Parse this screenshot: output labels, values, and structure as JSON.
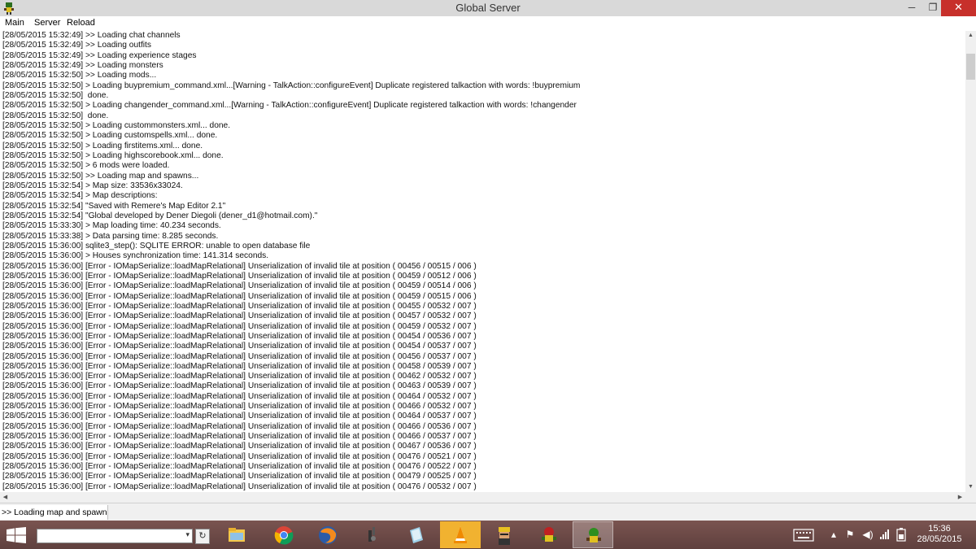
{
  "window": {
    "title": "Global Server",
    "minimize": "─",
    "maximize": "❐",
    "close": "✕"
  },
  "menu": [
    "Main",
    "Server",
    "Reload"
  ],
  "console_lines": [
    "[28/05/2015 15:32:49] >> Loading chat channels",
    "[28/05/2015 15:32:49] >> Loading outfits",
    "[28/05/2015 15:32:49] >> Loading experience stages",
    "[28/05/2015 15:32:49] >> Loading monsters",
    "[28/05/2015 15:32:50] >> Loading mods...",
    "[28/05/2015 15:32:50] > Loading buypremium_command.xml...[Warning - TalkAction::configureEvent] Duplicate registered talkaction with words: !buypremium",
    "[28/05/2015 15:32:50]  done.",
    "[28/05/2015 15:32:50] > Loading changender_command.xml...[Warning - TalkAction::configureEvent] Duplicate registered talkaction with words: !changender",
    "[28/05/2015 15:32:50]  done.",
    "[28/05/2015 15:32:50] > Loading custommonsters.xml... done.",
    "[28/05/2015 15:32:50] > Loading customspells.xml... done.",
    "[28/05/2015 15:32:50] > Loading firstitems.xml... done.",
    "[28/05/2015 15:32:50] > Loading highscorebook.xml... done.",
    "[28/05/2015 15:32:50] > 6 mods were loaded.",
    "[28/05/2015 15:32:50] >> Loading map and spawns...",
    "[28/05/2015 15:32:54] > Map size: 33536x33024.",
    "[28/05/2015 15:32:54] > Map descriptions:",
    "[28/05/2015 15:32:54] \"Saved with Remere's Map Editor 2.1\"",
    "[28/05/2015 15:32:54] \"Global developed by Dener Diegoli (dener_d1@hotmail.com).\"",
    "[28/05/2015 15:33:30] > Map loading time: 40.234 seconds.",
    "[28/05/2015 15:33:38] > Data parsing time: 8.285 seconds.",
    "[28/05/2015 15:36:00] sqlite3_step(): SQLITE ERROR: unable to open database file",
    "[28/05/2015 15:36:00] > Houses synchronization time: 141.314 seconds.",
    "[28/05/2015 15:36:00] [Error - IOMapSerialize::loadMapRelational] Unserialization of invalid tile at position ( 00456 / 00515 / 006 )",
    "[28/05/2015 15:36:00] [Error - IOMapSerialize::loadMapRelational] Unserialization of invalid tile at position ( 00459 / 00512 / 006 )",
    "[28/05/2015 15:36:00] [Error - IOMapSerialize::loadMapRelational] Unserialization of invalid tile at position ( 00459 / 00514 / 006 )",
    "[28/05/2015 15:36:00] [Error - IOMapSerialize::loadMapRelational] Unserialization of invalid tile at position ( 00459 / 00515 / 006 )",
    "[28/05/2015 15:36:00] [Error - IOMapSerialize::loadMapRelational] Unserialization of invalid tile at position ( 00455 / 00532 / 007 )",
    "[28/05/2015 15:36:00] [Error - IOMapSerialize::loadMapRelational] Unserialization of invalid tile at position ( 00457 / 00532 / 007 )",
    "[28/05/2015 15:36:00] [Error - IOMapSerialize::loadMapRelational] Unserialization of invalid tile at position ( 00459 / 00532 / 007 )",
    "[28/05/2015 15:36:00] [Error - IOMapSerialize::loadMapRelational] Unserialization of invalid tile at position ( 00454 / 00536 / 007 )",
    "[28/05/2015 15:36:00] [Error - IOMapSerialize::loadMapRelational] Unserialization of invalid tile at position ( 00454 / 00537 / 007 )",
    "[28/05/2015 15:36:00] [Error - IOMapSerialize::loadMapRelational] Unserialization of invalid tile at position ( 00456 / 00537 / 007 )",
    "[28/05/2015 15:36:00] [Error - IOMapSerialize::loadMapRelational] Unserialization of invalid tile at position ( 00458 / 00539 / 007 )",
    "[28/05/2015 15:36:00] [Error - IOMapSerialize::loadMapRelational] Unserialization of invalid tile at position ( 00462 / 00532 / 007 )",
    "[28/05/2015 15:36:00] [Error - IOMapSerialize::loadMapRelational] Unserialization of invalid tile at position ( 00463 / 00539 / 007 )",
    "[28/05/2015 15:36:00] [Error - IOMapSerialize::loadMapRelational] Unserialization of invalid tile at position ( 00464 / 00532 / 007 )",
    "[28/05/2015 15:36:00] [Error - IOMapSerialize::loadMapRelational] Unserialization of invalid tile at position ( 00466 / 00532 / 007 )",
    "[28/05/2015 15:36:00] [Error - IOMapSerialize::loadMapRelational] Unserialization of invalid tile at position ( 00464 / 00537 / 007 )",
    "[28/05/2015 15:36:00] [Error - IOMapSerialize::loadMapRelational] Unserialization of invalid tile at position ( 00466 / 00536 / 007 )",
    "[28/05/2015 15:36:00] [Error - IOMapSerialize::loadMapRelational] Unserialization of invalid tile at position ( 00466 / 00537 / 007 )",
    "[28/05/2015 15:36:00] [Error - IOMapSerialize::loadMapRelational] Unserialization of invalid tile at position ( 00467 / 00536 / 007 )",
    "[28/05/2015 15:36:00] [Error - IOMapSerialize::loadMapRelational] Unserialization of invalid tile at position ( 00476 / 00521 / 007 )",
    "[28/05/2015 15:36:00] [Error - IOMapSerialize::loadMapRelational] Unserialization of invalid tile at position ( 00476 / 00522 / 007 )",
    "[28/05/2015 15:36:00] [Error - IOMapSerialize::loadMapRelational] Unserialization of invalid tile at position ( 00479 / 00525 / 007 )",
    "[28/05/2015 15:36:00] [Error - IOMapSerialize::loadMapRelational] Unserialization of invalid tile at position ( 00476 / 00532 / 007 )"
  ],
  "status_text": ">> Loading map and spawns...",
  "taskbar": {
    "search_placeholder": "",
    "apps": [
      {
        "name": "file-explorer-icon",
        "active": false
      },
      {
        "name": "chrome-icon",
        "active": false
      },
      {
        "name": "firefox-icon",
        "active": false
      },
      {
        "name": "tool-icon",
        "active": false
      },
      {
        "name": "notepad-icon",
        "active": false
      },
      {
        "name": "vlc-icon",
        "active": false
      },
      {
        "name": "character-icon",
        "active": false
      },
      {
        "name": "server-icon",
        "active": false
      },
      {
        "name": "global-server-icon",
        "active": true
      }
    ],
    "clock_time": "15:36",
    "clock_date": "28/05/2015"
  },
  "colors": {
    "close_button": "#c7302b",
    "taskbar": "#6e4a4a",
    "vlc_highlight": "#f1b230"
  }
}
